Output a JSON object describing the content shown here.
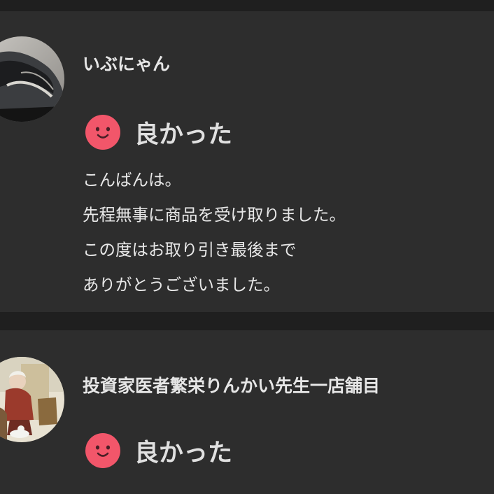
{
  "reviews": [
    {
      "username": "いぶにゃん",
      "rating_label": "良かった",
      "comment_lines": [
        "こんばんは。",
        "先程無事に商品を受け取りました。",
        "この度はお取り引き最後まで",
        "ありがとうございました。"
      ]
    },
    {
      "username": "投資家医者繁栄りんかい先生一店舗目",
      "rating_label": "良かった"
    }
  ],
  "icons": {
    "rating": "smile-icon"
  },
  "colors": {
    "page_background": "#1f1f1f",
    "card_background": "#2d2d2d",
    "smile_icon": "#f2566a",
    "text": "#e6e6e6"
  }
}
